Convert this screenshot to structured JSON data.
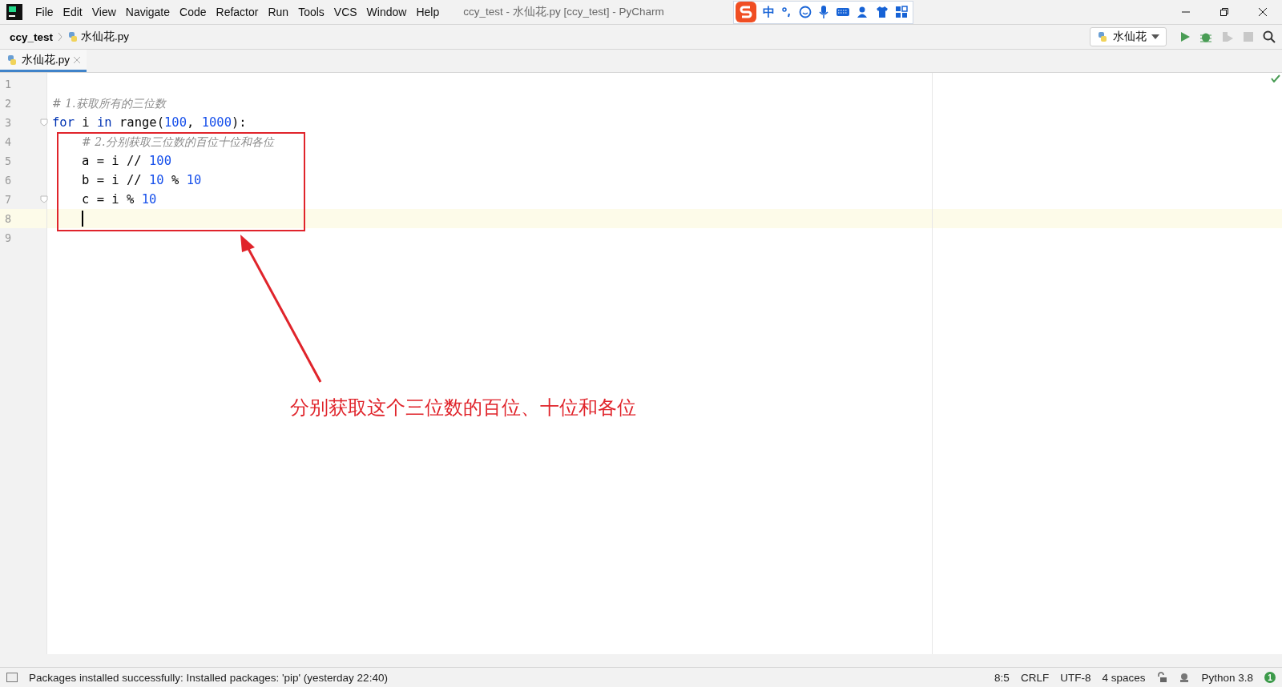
{
  "window": {
    "title": "ccy_test - 水仙花.py [ccy_test] - PyCharm"
  },
  "menu": [
    "File",
    "Edit",
    "View",
    "Navigate",
    "Code",
    "Refactor",
    "Run",
    "Tools",
    "VCS",
    "Window",
    "Help"
  ],
  "ime": {
    "label": "中"
  },
  "breadcrumbs": [
    "ccy_test",
    "水仙花.py"
  ],
  "run_config": {
    "label": "水仙花"
  },
  "tabs": [
    {
      "label": "水仙花.py",
      "selected": true
    }
  ],
  "editor": {
    "lines": [
      {
        "number": "1",
        "current": false,
        "fold": false,
        "indented": false
      },
      {
        "number": "2",
        "current": false,
        "fold": false,
        "indented": false,
        "tokens": [
          {
            "kind": "comment",
            "text": "# 1.获取所有的三位数"
          }
        ]
      },
      {
        "number": "3",
        "current": false,
        "fold": true,
        "indented": false,
        "tokens": [
          {
            "kind": "keyword",
            "text": "for"
          },
          {
            "kind": "plain",
            "text": " i "
          },
          {
            "kind": "keyword",
            "text": "in"
          },
          {
            "kind": "plain",
            "text": " range("
          },
          {
            "kind": "number",
            "text": "100"
          },
          {
            "kind": "plain",
            "text": ", "
          },
          {
            "kind": "number",
            "text": "1000"
          },
          {
            "kind": "plain",
            "text": "):"
          }
        ]
      },
      {
        "number": "4",
        "current": false,
        "fold": false,
        "indented": true,
        "tokens": [
          {
            "kind": "comment",
            "text": "# 2.分别获取三位数的百位十位和各位"
          }
        ]
      },
      {
        "number": "5",
        "current": false,
        "fold": false,
        "indented": true,
        "tokens": [
          {
            "kind": "plain",
            "text": "a = i // "
          },
          {
            "kind": "number",
            "text": "100"
          }
        ]
      },
      {
        "number": "6",
        "current": false,
        "fold": false,
        "indented": true,
        "tokens": [
          {
            "kind": "plain",
            "text": "b = i // "
          },
          {
            "kind": "number",
            "text": "10"
          },
          {
            "kind": "plain",
            "text": " % "
          },
          {
            "kind": "number",
            "text": "10"
          }
        ]
      },
      {
        "number": "7",
        "current": false,
        "fold": true,
        "indented": true,
        "tokens": [
          {
            "kind": "plain",
            "text": "c = i % "
          },
          {
            "kind": "number",
            "text": "10"
          }
        ]
      },
      {
        "number": "8",
        "current": true,
        "fold": false,
        "indented": true,
        "caret": true
      },
      {
        "number": "9",
        "current": false,
        "fold": false,
        "indented": false
      }
    ],
    "annotation": {
      "text": "分别获取这个三位数的百位、十位和各位"
    }
  },
  "status_bar": {
    "message": "Packages installed successfully: Installed packages: 'pip' (yesterday 22:40)",
    "items": [
      "8:5",
      "CRLF",
      "UTF-8",
      "4 spaces"
    ],
    "interpreter": "Python 3.8",
    "notifications": "1"
  }
}
